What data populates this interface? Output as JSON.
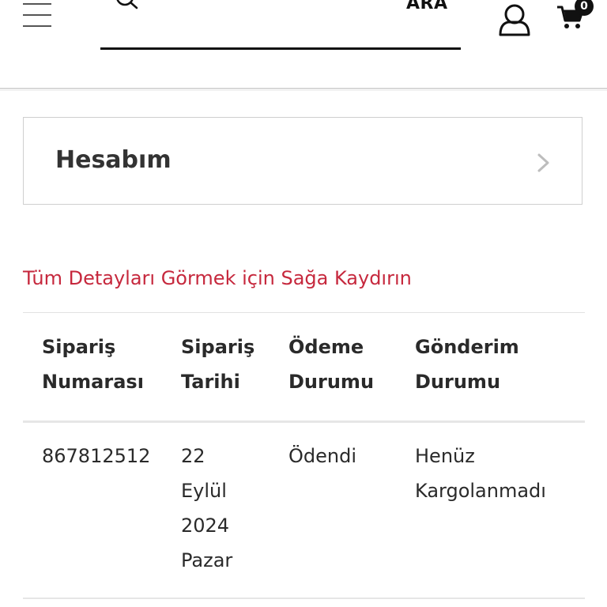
{
  "header": {
    "search": {
      "value": "",
      "placeholder": "",
      "button_label": "ARA"
    },
    "cart": {
      "count": "0"
    },
    "icons": {
      "menu": "hamburger-icon",
      "search": "search-icon",
      "user": "user-icon",
      "cart": "cart-icon"
    }
  },
  "account": {
    "title": "Hesabım",
    "chevron": "chevron-right-icon"
  },
  "hint": "Tüm Detayları Görmek için Sağa Kaydırın",
  "orders": {
    "headers": [
      [
        "Sipariş",
        "Numarası"
      ],
      [
        "Sipariş",
        "Tarihi"
      ],
      [
        "Ödeme",
        "Durumu"
      ],
      [
        "Gönderim",
        "Durumu"
      ]
    ],
    "rows": [
      {
        "order_number": [
          "867812512"
        ],
        "order_date": [
          "22",
          "Eylül",
          "2024",
          "Pazar"
        ],
        "payment_status": [
          "Ödendi"
        ],
        "shipping_status": [
          "Henüz",
          "Kargolanmadı"
        ]
      }
    ]
  },
  "colors": {
    "accent": "#c6283d",
    "text": "#2a2a2a",
    "border": "#cfcfcf"
  }
}
